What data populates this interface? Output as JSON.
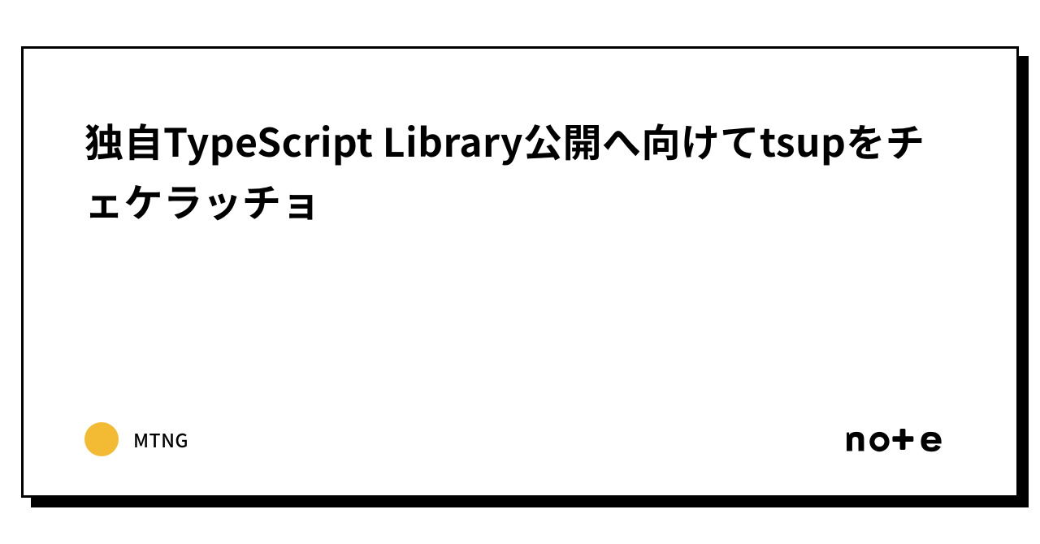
{
  "card": {
    "title": "独自TypeScript Library公開へ向けてtsupをチェケラッチョ"
  },
  "author": {
    "name": "MTNG",
    "avatar_color": "#f2bb33"
  },
  "brand": {
    "name": "note"
  }
}
